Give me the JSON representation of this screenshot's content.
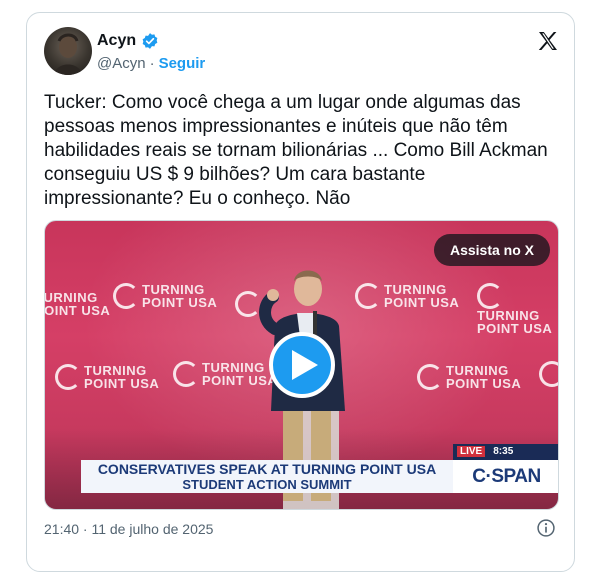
{
  "author": {
    "name": "Acyn",
    "handle": "@Acyn",
    "separator": "·",
    "follow_label": "Seguir"
  },
  "tweet": {
    "text": "Tucker: Como você chega a um lugar onde algumas das pessoas menos impressionantes e inúteis que não têm habilidades reais se tornam bilionárias ... Como Bill Ackman conseguiu US $ 9 bilhões? Um cara bastante impressionante? Eu o conheço. Não"
  },
  "media": {
    "watch_label": "Assista no X",
    "logo_line1": "TURNING",
    "logo_line2": "POINT USA",
    "chyron_line1": "CONSERVATIVES SPEAK AT TURNING POINT USA",
    "chyron_line2": "STUDENT ACTION SUMMIT",
    "live_label": "LIVE",
    "clock": "8:35",
    "network": "C·SPAN"
  },
  "footer": {
    "timestamp": "21:40 · 11 de julho de 2025"
  },
  "colors": {
    "accent": "#1d9bf0",
    "text": "#0f1419",
    "muted": "#536471"
  },
  "icons": [
    "verified-badge-icon",
    "x-logo-icon",
    "play-icon",
    "info-icon"
  ]
}
